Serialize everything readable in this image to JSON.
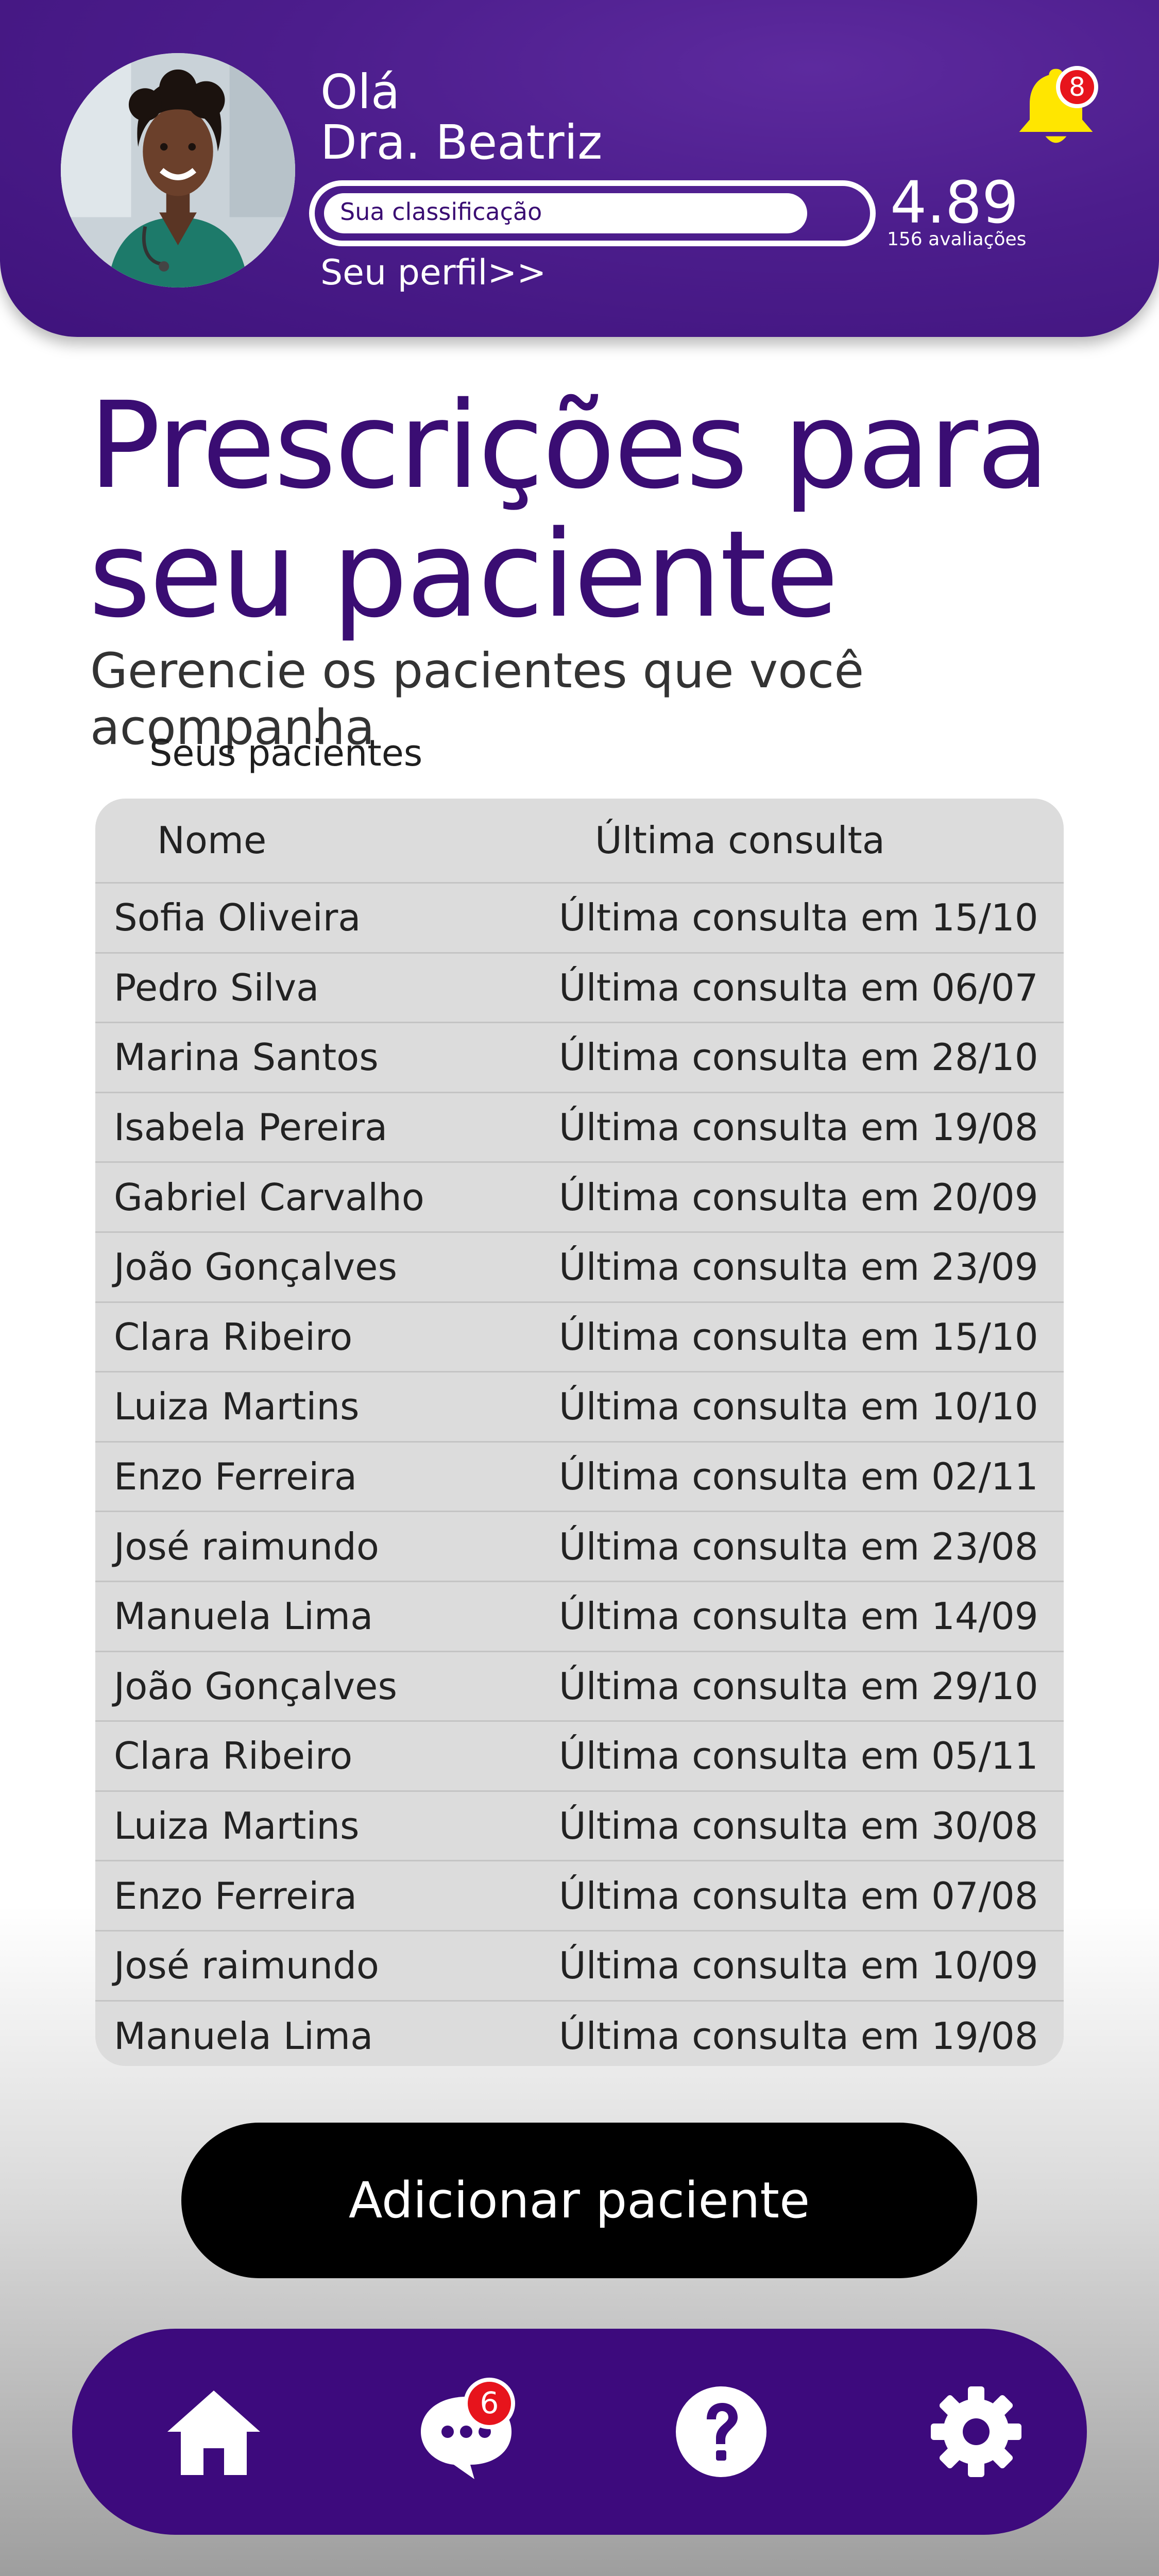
{
  "header": {
    "greeting": "Olá",
    "doctor_name": "Dra. Beatriz",
    "rating_label": "Sua classificação",
    "rating_value": "4.89",
    "rating_count": "156 avaliações",
    "rating_fill_fraction": 0.9,
    "profile_link": "Seu perfil>>",
    "notification_count": "8",
    "avatar_icon": "doctor-avatar",
    "bell_icon": "bell-icon"
  },
  "main": {
    "title": "Prescrições para seu paciente",
    "subtitle": "Gerencie os pacientes que você acompanha",
    "section_label": "Seus pacientes"
  },
  "table": {
    "columns": [
      "Nome",
      "Última consulta"
    ],
    "rows": [
      {
        "name": "Sofia Oliveira",
        "last_visit": "Última consulta em 15/10"
      },
      {
        "name": "Pedro Silva",
        "last_visit": "Última consulta em 06/07"
      },
      {
        "name": "Marina Santos",
        "last_visit": "Última consulta em 28/10"
      },
      {
        "name": "Isabela Pereira",
        "last_visit": "Última consulta em 19/08"
      },
      {
        "name": "Gabriel Carvalho",
        "last_visit": "Última consulta em 20/09"
      },
      {
        "name": "João Gonçalves",
        "last_visit": "Última consulta em 23/09"
      },
      {
        "name": "Clara Ribeiro",
        "last_visit": "Última consulta em 15/10"
      },
      {
        "name": "Luiza Martins",
        "last_visit": "Última consulta em 10/10"
      },
      {
        "name": "Enzo Ferreira",
        "last_visit": "Última consulta em 02/11"
      },
      {
        "name": "José raimundo",
        "last_visit": "Última consulta em 23/08"
      },
      {
        "name": "Manuela Lima",
        "last_visit": "Última consulta em 14/09"
      },
      {
        "name": "João Gonçalves",
        "last_visit": "Última consulta em 29/10"
      },
      {
        "name": "Clara Ribeiro",
        "last_visit": "Última consulta em 05/11"
      },
      {
        "name": "Luiza Martins",
        "last_visit": "Última consulta em 30/08"
      },
      {
        "name": "Enzo Ferreira",
        "last_visit": "Última consulta em 07/08"
      },
      {
        "name": "José raimundo",
        "last_visit": "Última consulta em 10/09"
      },
      {
        "name": "Manuela Lima",
        "last_visit": "Última consulta em 19/08"
      }
    ]
  },
  "actions": {
    "add_patient_label": "Adicionar paciente"
  },
  "bottom_nav": {
    "items": [
      {
        "icon": "home-icon"
      },
      {
        "icon": "chat-icon",
        "badge": "6"
      },
      {
        "icon": "help-icon"
      },
      {
        "icon": "settings-icon"
      }
    ]
  },
  "colors": {
    "brand_purple": "#4c1d8c",
    "title_purple": "#3a0d73",
    "nav_purple": "#3d0a7d",
    "bell_yellow": "#ffe600",
    "badge_red": "#e7141c",
    "table_bg": "#dcdcdc"
  }
}
